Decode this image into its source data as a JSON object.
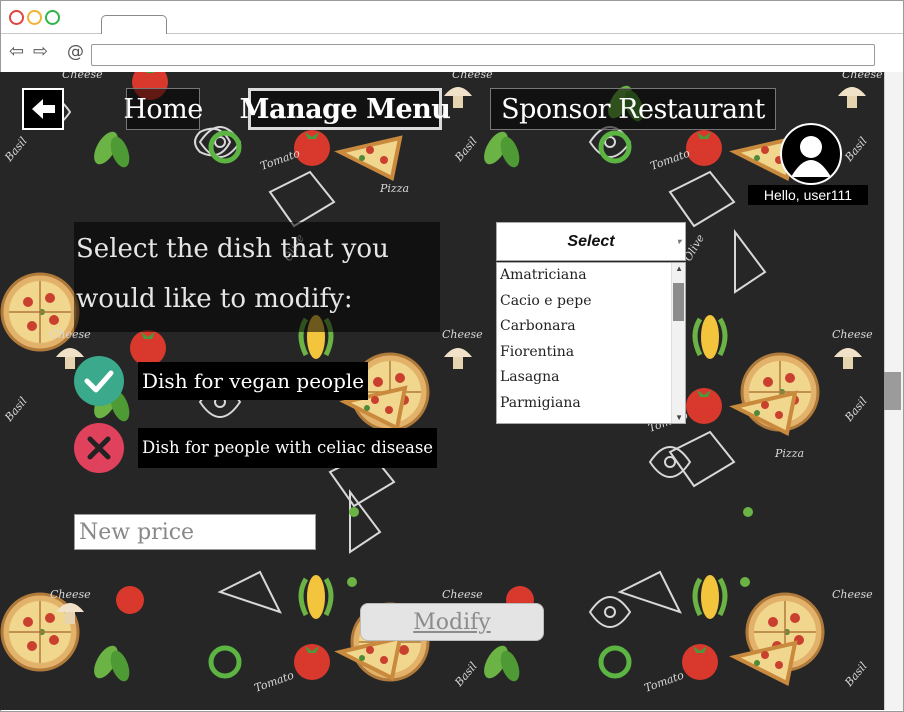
{
  "browser": {
    "url": ""
  },
  "nav": {
    "back_label": "back",
    "home": "Home",
    "manage_menu": "Manage Menu",
    "sponsor": "Sponsor Restaurant"
  },
  "user": {
    "greeting": "Hello, user111"
  },
  "form": {
    "prompt_line1": "Select the dish that you",
    "prompt_line2": "would like to modify:",
    "select_label": "Select",
    "dishes": [
      "Amatriciana",
      "Cacio e pepe",
      "Carbonara",
      "Fiorentina",
      "Lasagna",
      "Parmigiana"
    ],
    "vegan_label": "Dish for vegan people",
    "celiac_label": "Dish for people with celiac disease",
    "price_placeholder": "New price",
    "modify_button": "Modify"
  },
  "colors": {
    "vegan_check": "#3aa98c",
    "celiac_cross": "#e0415d",
    "background": "#262626"
  }
}
